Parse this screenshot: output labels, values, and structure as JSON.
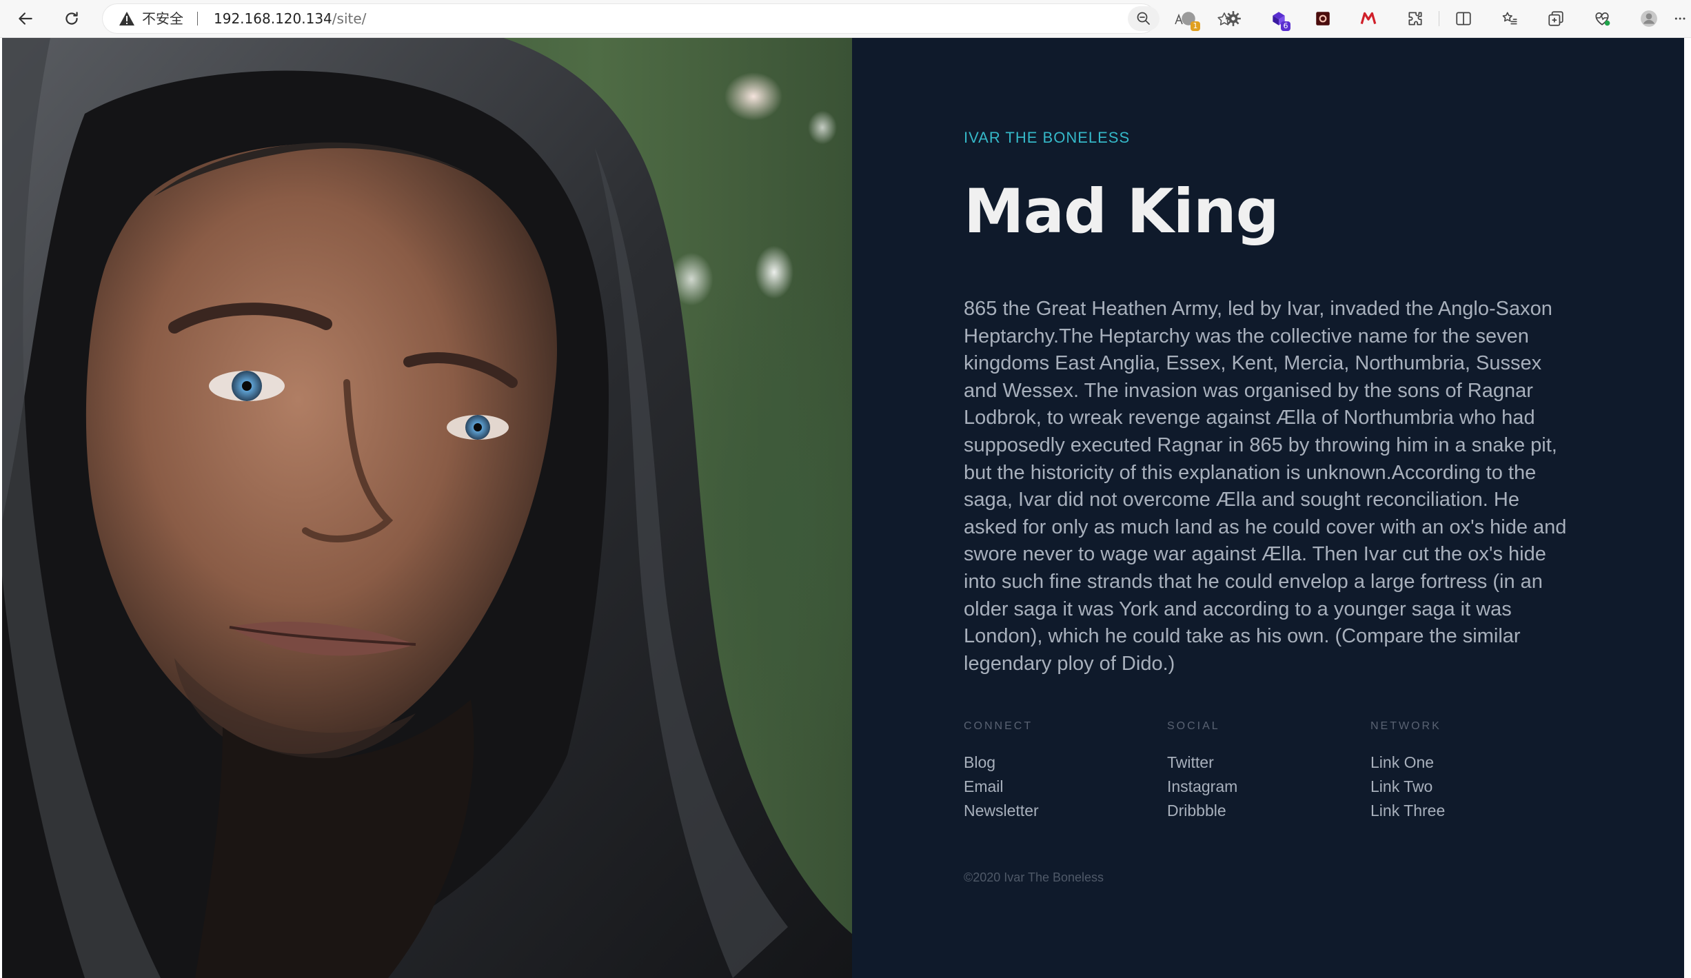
{
  "browser": {
    "insecure_label": "不安全",
    "url_host": "192.168.120.134",
    "url_path": "/site/",
    "extension_badges": {
      "ext1": "1",
      "ext3": "6"
    }
  },
  "hero": {
    "image": "hooded-man-portrait"
  },
  "content": {
    "eyebrow": "IVAR THE BONELESS",
    "title": "Mad King",
    "body": "865 the Great Heathen Army, led by Ivar, invaded the Anglo-Saxon Heptarchy.The Heptarchy was the collective name for the seven kingdoms East Anglia, Essex, Kent, Mercia, Northumbria, Sussex and Wessex. The invasion was organised by the sons of Ragnar Lodbrok, to wreak revenge against Ælla of Northumbria who had supposedly executed Ragnar in 865 by throwing him in a snake pit, but the historicity of this explanation is unknown.According to the saga, Ivar did not overcome Ælla and sought reconciliation. He asked for only as much land as he could cover with an ox's hide and swore never to wage war against Ælla. Then Ivar cut the ox's hide into such fine strands that he could envelop a large fortress (in an older saga it was York and according to a younger saga it was London), which he could take as his own. (Compare the similar legendary ploy of Dido.)"
  },
  "footer": {
    "columns": [
      {
        "heading": "CONNECT",
        "links": [
          "Blog",
          "Email",
          "Newsletter"
        ]
      },
      {
        "heading": "SOCIAL",
        "links": [
          "Twitter",
          "Instagram",
          "Dribbble"
        ]
      },
      {
        "heading": "NETWORK",
        "links": [
          "Link One",
          "Link Two",
          "Link Three"
        ]
      }
    ],
    "copyright": "©2020 Ivar The Boneless"
  },
  "colors": {
    "page_bg": "#0f1a2b",
    "accent": "#35b8c8",
    "title": "#f0f0f0",
    "body_text": "#a8b0bc",
    "muted": "#596272"
  }
}
